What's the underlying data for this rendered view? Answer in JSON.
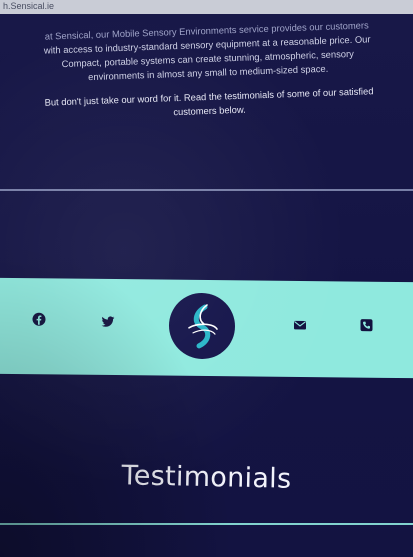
{
  "browser": {
    "address": "h.Sensical.ie"
  },
  "intro": {
    "line1": "at Sensical, our Mobile Sensory Environments service provides our customers",
    "line2": "with access to industry-standard sensory equipment at a reasonable price. Our",
    "line3": "Compact, portable systems can create stunning, atmospheric, sensory",
    "line4": "environments in almost any small to medium-sized space.",
    "quote_line1": "But don't just take our word for it. Read the testimonials of some of our satisfied",
    "quote_line2": "customers below."
  },
  "social": {
    "icons": [
      "facebook-icon",
      "twitter-icon",
      "logo",
      "mail-icon",
      "phone-icon"
    ]
  },
  "section": {
    "title": "Testimonials"
  },
  "colors": {
    "background": "#12123f",
    "band": "#8fe9de",
    "accent": "#29b6c8"
  }
}
